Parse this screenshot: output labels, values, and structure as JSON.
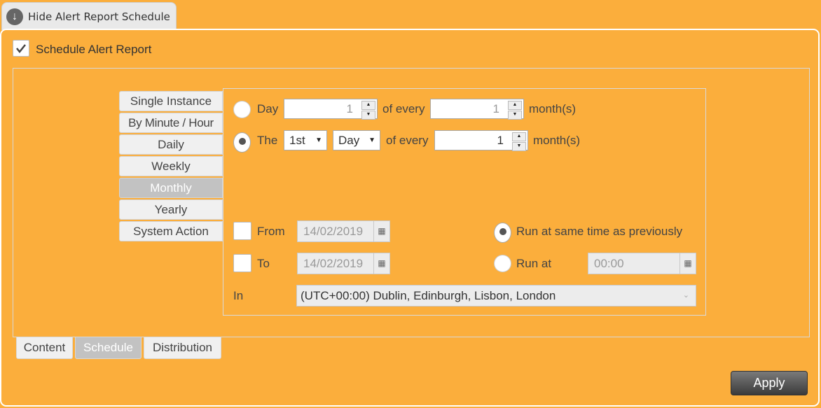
{
  "header": {
    "tab_label": "Hide Alert Report Schedule",
    "tab_icon": "arrow-down-circle-icon"
  },
  "schedule_checkbox": {
    "label": "Schedule Alert Report",
    "checked": true
  },
  "freq_tabs": [
    {
      "label": "Single Instance",
      "active": false
    },
    {
      "label": "By Minute / Hour",
      "active": false
    },
    {
      "label": "Daily",
      "active": false
    },
    {
      "label": "Weekly",
      "active": false
    },
    {
      "label": "Monthly",
      "active": true
    },
    {
      "label": "Yearly",
      "active": false
    },
    {
      "label": "System Action",
      "active": false
    }
  ],
  "monthly": {
    "day_option": {
      "label": "Day",
      "day_value": "1",
      "of_every": "of every",
      "month_value": "1",
      "months": "month(s)",
      "selected": false
    },
    "the_option": {
      "label": "The",
      "ordinal": "1st",
      "day_type": "Day",
      "of_every": "of every",
      "month_value": "1",
      "months": "month(s)",
      "selected": true
    }
  },
  "range": {
    "from": {
      "label": "From",
      "value": "14/02/2019",
      "checked": false
    },
    "to": {
      "label": "To",
      "value": "14/02/2019",
      "checked": false
    }
  },
  "run": {
    "same_time": {
      "label": "Run at same time as previously",
      "selected": true
    },
    "run_at": {
      "label": "Run at",
      "value": "00:00",
      "selected": false
    }
  },
  "timezone": {
    "label": "In",
    "value": "(UTC+00:00) Dublin, Edinburgh, Lisbon, London"
  },
  "bottom_tabs": [
    {
      "label": "Content",
      "active": false
    },
    {
      "label": "Schedule",
      "active": true
    },
    {
      "label": "Distribution",
      "active": false
    }
  ],
  "apply_label": "Apply",
  "colors": {
    "background": "#fbae3c",
    "active_tab": "#c2c2c2"
  }
}
